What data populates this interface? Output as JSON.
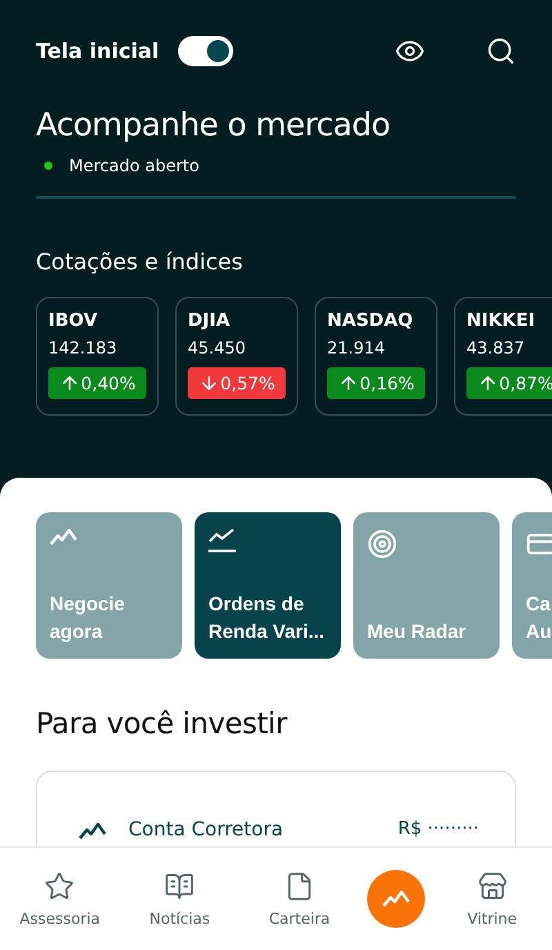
{
  "header": {
    "title": "Tela inicial",
    "toggle_on": true
  },
  "market": {
    "title": "Acompanhe o mercado",
    "status": "Mercado aberto"
  },
  "quotes": {
    "title": "Cotações e índices",
    "items": [
      {
        "name": "IBOV",
        "value": "142.183",
        "change": "0,40%",
        "rising": true
      },
      {
        "name": "DJIA",
        "value": "45.450",
        "change": "0,57%",
        "rising": false
      },
      {
        "name": "NASDAQ",
        "value": "21.914",
        "change": "0,16%",
        "rising": true
      },
      {
        "name": "NIKKEI",
        "value": "43.837",
        "change": "0,87%",
        "rising": true
      }
    ]
  },
  "shortcuts": [
    {
      "lines": [
        "Negocie",
        "agora"
      ],
      "kind": "trade",
      "selected": false
    },
    {
      "lines": [
        "Ordens de",
        "Renda Vari..."
      ],
      "kind": "orders",
      "selected": true
    },
    {
      "lines": [
        "Meu Radar"
      ],
      "kind": "radar",
      "selected": false
    },
    {
      "lines": [
        "Ca",
        "Au"
      ],
      "kind": "card",
      "selected": false
    }
  ],
  "invest": {
    "title": "Para você investir",
    "account": "Conta Corretora",
    "balance": "R$ ·········"
  },
  "nav": [
    {
      "label": "Assessoria",
      "kind": "star"
    },
    {
      "label": "Notícias",
      "kind": "news"
    },
    {
      "label": "Carteira",
      "kind": "file"
    },
    {
      "kind": "fab"
    },
    {
      "label": "Vitrine",
      "kind": "store"
    }
  ]
}
